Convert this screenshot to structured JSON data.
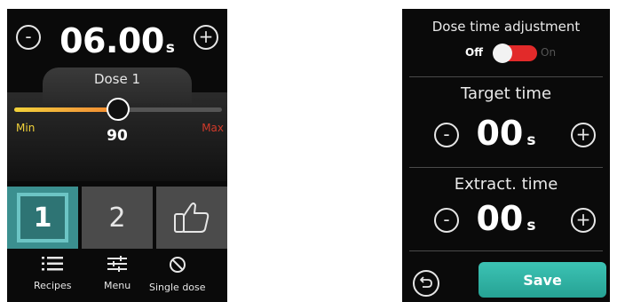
{
  "left": {
    "dose_time": {
      "value": "06.00",
      "unit": "s"
    },
    "decrement_label": "-",
    "increment_label": "+",
    "dose_label": "Dose 1",
    "slider": {
      "min_label": "Min",
      "max_label": "Max",
      "value": "90",
      "fill_fraction": 0.5
    },
    "presets": [
      {
        "label": "1",
        "active": true
      },
      {
        "label": "2",
        "active": false
      },
      {
        "icon": "thumbs-up-icon"
      }
    ],
    "nav": [
      {
        "label": "Recipes",
        "icon": "list-icon"
      },
      {
        "label": "Menu",
        "icon": "sliders-icon"
      },
      {
        "label": "Single dose",
        "icon": "no-symbol-icon"
      }
    ]
  },
  "right": {
    "title": "Dose time adjustment",
    "toggle": {
      "off_label": "Off",
      "on_label": "On",
      "state": "off"
    },
    "target": {
      "title": "Target time",
      "value": "00",
      "unit": "s"
    },
    "extract": {
      "title": "Extract. time",
      "value": "00",
      "unit": "s"
    },
    "decrement_label": "-",
    "increment_label": "+",
    "save_label": "Save",
    "back_icon": "back-arrow-icon"
  },
  "colors": {
    "accent_teal": "#3cc3b4",
    "toggle_red": "#e22a2a",
    "min_yellow": "#f2d23a",
    "max_red": "#d13a2a",
    "preset_active": "#3b8f8f"
  }
}
